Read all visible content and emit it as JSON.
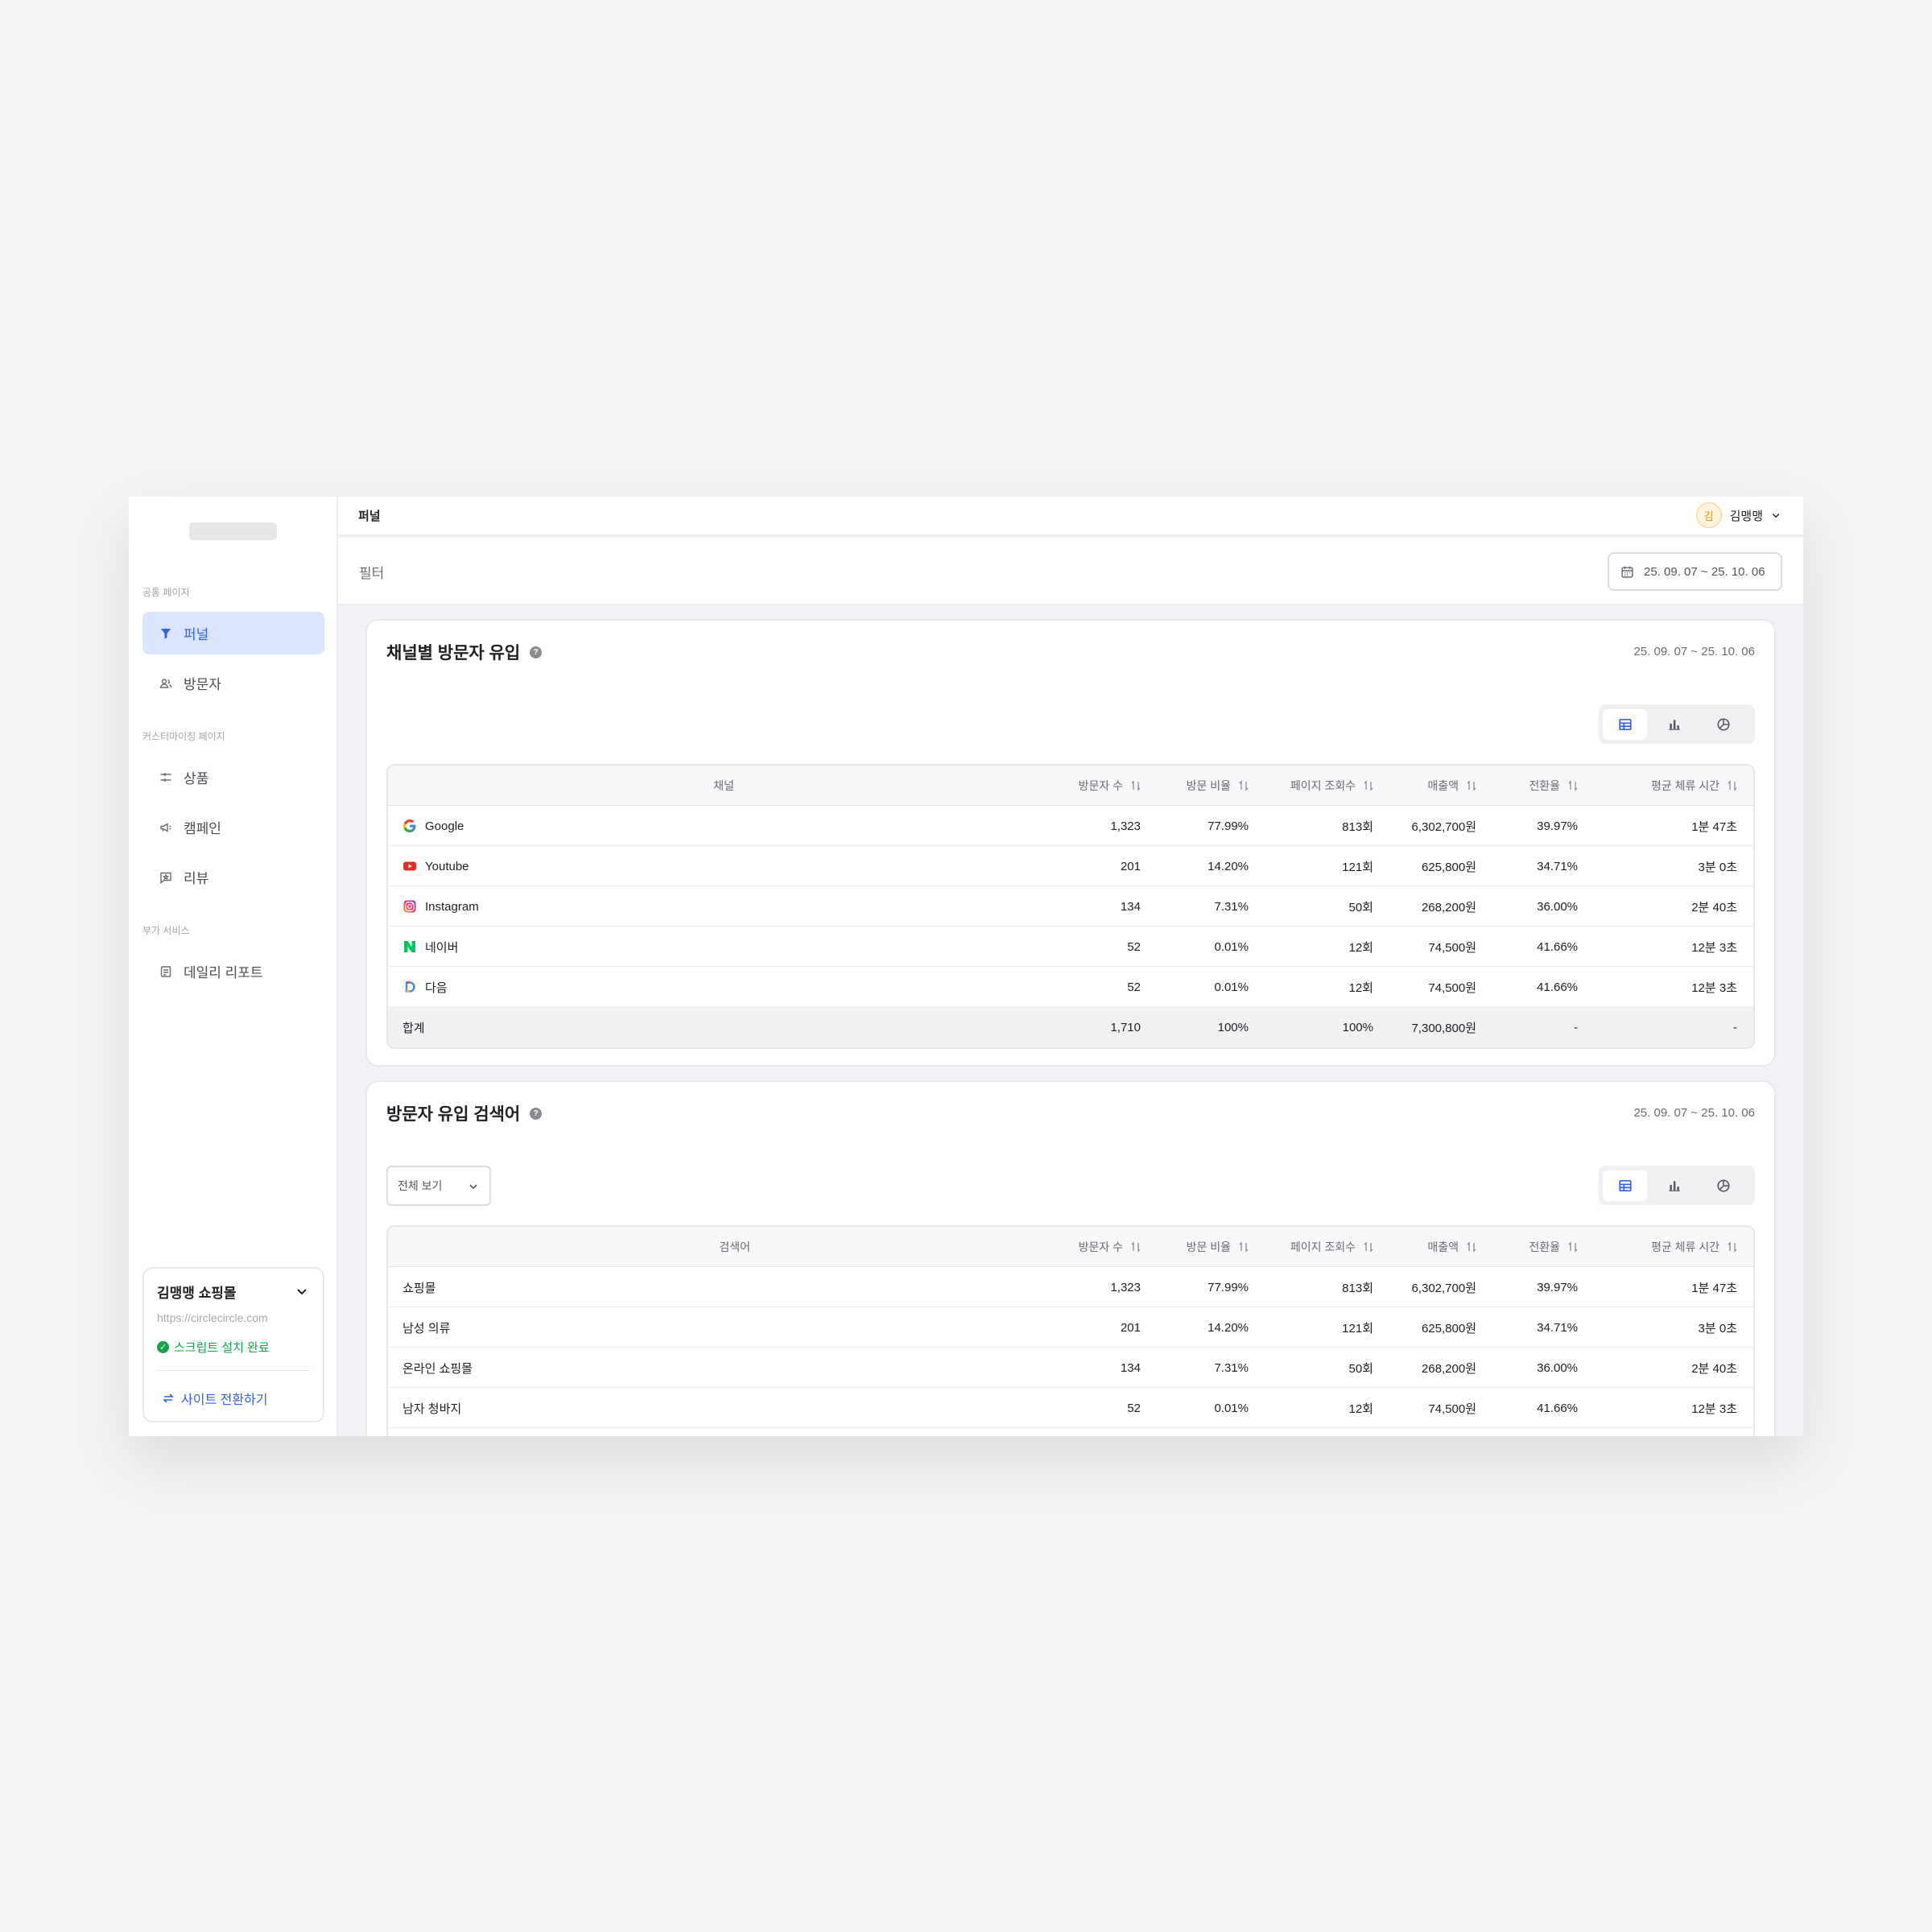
{
  "sidebar": {
    "sections": [
      "공통 페이지",
      "커스터마이징 페이지",
      "부가 서비스"
    ],
    "items": [
      {
        "label": "퍼널"
      },
      {
        "label": "방문자"
      },
      {
        "label": "상품"
      },
      {
        "label": "캠페인"
      },
      {
        "label": "리뷰"
      },
      {
        "label": "데일리 리포트"
      }
    ],
    "site": {
      "name": "김맹맹 쇼핑몰",
      "url": "https://circlecircle.com",
      "status": "스크립트 설치 완료",
      "switch_label": "사이트 전환하기"
    }
  },
  "header": {
    "title": "퍼널",
    "user_initial": "김",
    "user_name": "김맹맹"
  },
  "filter": {
    "label": "필터",
    "date_range": "25. 09. 07 ~ 25. 10. 06"
  },
  "channel_card": {
    "title": "채널별 방문자 유입",
    "date_range": "25. 09. 07 ~ 25. 10. 06",
    "columns": [
      "채널",
      "방문자 수",
      "방문 비율",
      "페이지 조회수",
      "매출액",
      "전환율",
      "평균 체류 시간"
    ],
    "rows": [
      {
        "name": "Google",
        "icon": "google-icon",
        "visitors": "1,323",
        "ratio": "77.99%",
        "views": "813회",
        "sales": "6,302,700원",
        "conv": "39.97%",
        "stay": "1분 47초"
      },
      {
        "name": "Youtube",
        "icon": "youtube-icon",
        "visitors": "201",
        "ratio": "14.20%",
        "views": "121회",
        "sales": "625,800원",
        "conv": "34.71%",
        "stay": "3분 0초"
      },
      {
        "name": "Instagram",
        "icon": "instagram-icon",
        "visitors": "134",
        "ratio": "7.31%",
        "views": "50회",
        "sales": "268,200원",
        "conv": "36.00%",
        "stay": "2분 40초"
      },
      {
        "name": "네이버",
        "icon": "naver-icon",
        "visitors": "52",
        "ratio": "0.01%",
        "views": "12회",
        "sales": "74,500원",
        "conv": "41.66%",
        "stay": "12분 3초"
      },
      {
        "name": "다음",
        "icon": "daum-icon",
        "visitors": "52",
        "ratio": "0.01%",
        "views": "12회",
        "sales": "74,500원",
        "conv": "41.66%",
        "stay": "12분 3초"
      }
    ],
    "total": {
      "name": "합계",
      "visitors": "1,710",
      "ratio": "100%",
      "views": "100%",
      "sales": "7,300,800원",
      "conv": "-",
      "stay": "-"
    }
  },
  "keyword_card": {
    "title": "방문자 유입 검색어",
    "date_range": "25. 09. 07 ~ 25. 10. 06",
    "select_value": "전체 보기",
    "columns": [
      "검색어",
      "방문자 수",
      "방문 비율",
      "페이지 조회수",
      "매출액",
      "전환율",
      "평균 체류 시간"
    ],
    "rows": [
      {
        "name": "쇼핑몰",
        "visitors": "1,323",
        "ratio": "77.99%",
        "views": "813회",
        "sales": "6,302,700원",
        "conv": "39.97%",
        "stay": "1분 47초"
      },
      {
        "name": "남성 의류",
        "visitors": "201",
        "ratio": "14.20%",
        "views": "121회",
        "sales": "625,800원",
        "conv": "34.71%",
        "stay": "3분 0초"
      },
      {
        "name": "온라인 쇼핑몰",
        "visitors": "134",
        "ratio": "7.31%",
        "views": "50회",
        "sales": "268,200원",
        "conv": "36.00%",
        "stay": "2분 40초"
      },
      {
        "name": "남자 청바지",
        "visitors": "52",
        "ratio": "0.01%",
        "views": "12회",
        "sales": "74,500원",
        "conv": "41.66%",
        "stay": "12분 3초"
      }
    ]
  },
  "colors": {
    "accent": "#3461e0",
    "active_bg": "#dbe5fd",
    "success": "#16a34a"
  }
}
